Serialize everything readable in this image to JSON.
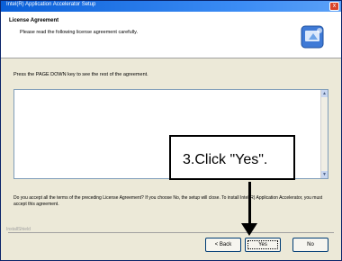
{
  "window": {
    "title": "Intel(R) Application Accelerator Setup",
    "close_glyph": "x"
  },
  "header": {
    "title": "License Agreement",
    "subtitle": "Please read the following license agreement carefully.",
    "icon": "setup-wizard-icon"
  },
  "body": {
    "instruction": "Press the PAGE DOWN key to see the rest of the agreement.",
    "question": "Do you accept all the terms of the preceding License Agreement? If you choose No, the setup will close. To install Intel(R) Application Accelerator, you must accept this agreement."
  },
  "footer": {
    "group_label": "InstallShield"
  },
  "buttons": {
    "back": "< Back",
    "yes": "Yes",
    "no": "No"
  },
  "callout": {
    "text": "3.Click \"Yes\"."
  }
}
